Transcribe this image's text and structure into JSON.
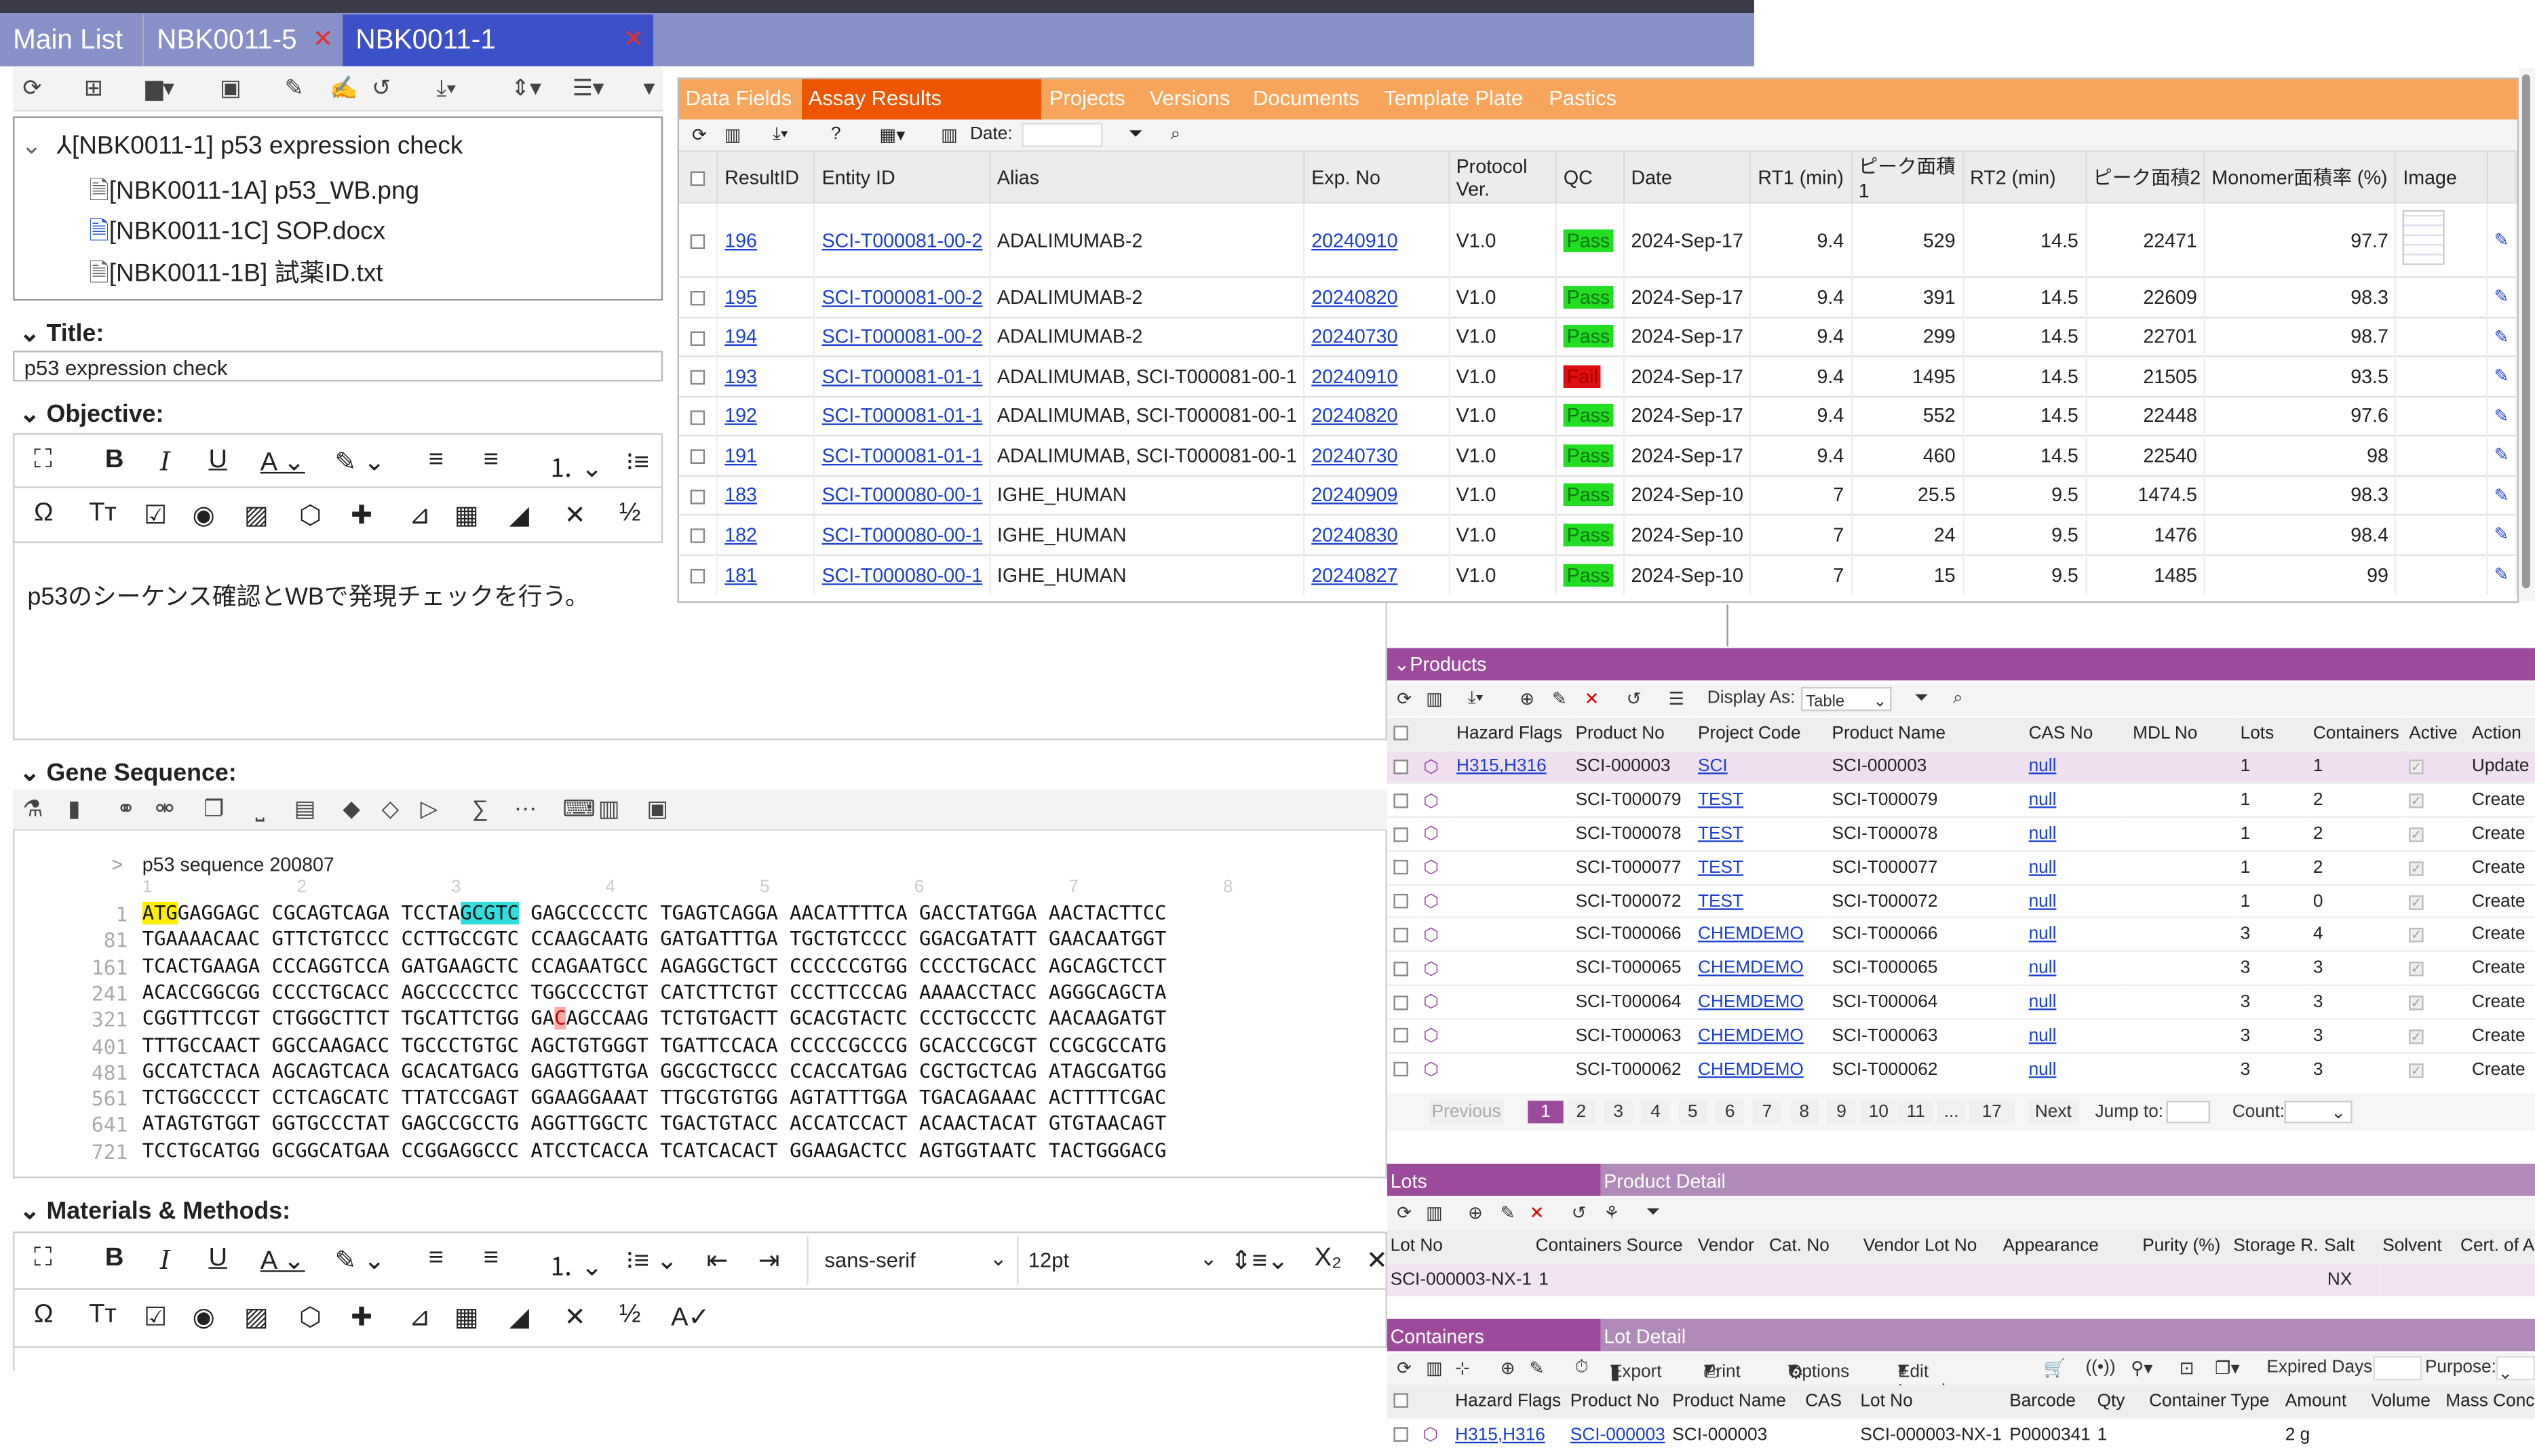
{
  "tabs": [
    {
      "label": "Main List"
    },
    {
      "label": "NBK0011-5",
      "close": "✕"
    },
    {
      "label": "NBK0011-1",
      "close": "✕"
    }
  ],
  "tree": {
    "root": "[NBK0011-1] p53 expression check",
    "items": [
      "[NBK0011-1A] p53_WB.png",
      "[NBK0011-1C] SOP.docx",
      "[NBK0011-1B] 試薬ID.txt"
    ]
  },
  "title": {
    "label": "Title:",
    "value": "p53 expression check"
  },
  "objective": {
    "label": "Objective:",
    "text": "p53のシーケンス確認とWBで発現チェックを行う。"
  },
  "gene": {
    "label": "Gene Sequence:",
    "seq_title": "p53 sequence 200807",
    "ruler": [
      "1",
      "2",
      "3",
      "4",
      "5",
      "6",
      "7",
      "8"
    ],
    "lines": [
      {
        "n": "1",
        "parts": [
          "",
          "ATG",
          "GAGGAGC CGCAGTCAGA TCCTA",
          "GCGTC",
          " GAGCCCCCTC TGAGTCAGGA AACATTTTCA GACCTATGGA AACTACTTCC"
        ]
      },
      {
        "n": "81",
        "t": "TGAAAACAAC GTTCTGTCCC CCTTGCCGTC CCAAGCAATG GATGATTTGA TGCTGTCCCC GGACGATATT GAACAATGGT"
      },
      {
        "n": "161",
        "t": "TCACTGAAGA CCCAGGTCCA GATGAAGCTC CCAGAATGCC AGAGGCTGCT CCCCCCGTGG CCCCTGCACC AGCAGCTCCT"
      },
      {
        "n": "241",
        "t": "ACACCGGCGG CCCCTGCACC AGCCCCCTCC TGGCCCCTGT CATCTTCTGT CCCTTCCCAG AAAACCTACC AGGGCAGCTA"
      },
      {
        "n": "321",
        "parts": [
          "CGGTTTCCGT CTGGGCTTCT TGCATTCTGG GA",
          "C",
          "AGCCAAG TCTGTGACTT GCACGTACTC CCCTGCCCTC AACAAGATGT"
        ]
      },
      {
        "n": "401",
        "t": "TTTGCCAACT GGCCAAGACC TGCCCTGTGC AGCTGTGGGT TGATTCCACA CCCCCGCCCG GCACCCGCGT CCGCGCCATG"
      },
      {
        "n": "481",
        "t": "GCCATCTACA AGCAGTCACA GCACATGACG GAGGTTGTGA GGCGCTGCCC CCACCATGAG CGCTGCTCAG ATAGCGATGG"
      },
      {
        "n": "561",
        "t": "TCTGGCCCCT CCTCAGCATC TTATCCGAGT GGAAGGAAAT TTGCGTGTGG AGTATTTGGA TGACAGAAAC ACTTTTCGAC"
      },
      {
        "n": "641",
        "t": "ATAGTGTGGT GGTGCCCTAT GAGCCGCCTG AGGTTGGCTC TGACTGTACC ACCATCCACT ACAACTACAT GTGTAACAGT"
      },
      {
        "n": "721",
        "t": "TCCTGCATGG GCGGCATGAA CCGGAGGCCC ATCCTCACCA TCATCACACT GGAAGACTCC AGTGGTAATC TACTGGGACG"
      }
    ]
  },
  "methods": {
    "label": "Materials & Methods:",
    "font": "sans-serif",
    "size": "12pt"
  },
  "assay": {
    "tabs": [
      "Data Fields",
      "Assay Results",
      "Projects",
      "Versions",
      "Documents",
      "Template Plate",
      "Pastics"
    ],
    "date_label": "Date:",
    "columns": [
      "ResultID",
      "Entity ID",
      "Alias",
      "Exp. No",
      "Protocol Ver.",
      "QC",
      "Date",
      "RT1 (min)",
      "ピーク面積1",
      "RT2 (min)",
      "ピーク面積2",
      "Monomer面積率 (%)",
      "Image"
    ],
    "rows": [
      {
        "id": "196",
        "entity": "SCI-T000081-00-2",
        "alias": "ADALIMUMAB-2",
        "exp": "20240910",
        "ver": "V1.0",
        "qc": "Pass",
        "date": "2024-Sep-17",
        "rt1": "9.4",
        "p1": "529",
        "rt2": "14.5",
        "p2": "22471",
        "mono": "97.7"
      },
      {
        "id": "195",
        "entity": "SCI-T000081-00-2",
        "alias": "ADALIMUMAB-2",
        "exp": "20240820",
        "ver": "V1.0",
        "qc": "Pass",
        "date": "2024-Sep-17",
        "rt1": "9.4",
        "p1": "391",
        "rt2": "14.5",
        "p2": "22609",
        "mono": "98.3"
      },
      {
        "id": "194",
        "entity": "SCI-T000081-00-2",
        "alias": "ADALIMUMAB-2",
        "exp": "20240730",
        "ver": "V1.0",
        "qc": "Pass",
        "date": "2024-Sep-17",
        "rt1": "9.4",
        "p1": "299",
        "rt2": "14.5",
        "p2": "22701",
        "mono": "98.7"
      },
      {
        "id": "193",
        "entity": "SCI-T000081-01-1",
        "alias": "ADALIMUMAB, SCI-T000081-00-1",
        "exp": "20240910",
        "ver": "V1.0",
        "qc": "Fail",
        "date": "2024-Sep-17",
        "rt1": "9.4",
        "p1": "1495",
        "rt2": "14.5",
        "p2": "21505",
        "mono": "93.5"
      },
      {
        "id": "192",
        "entity": "SCI-T000081-01-1",
        "alias": "ADALIMUMAB, SCI-T000081-00-1",
        "exp": "20240820",
        "ver": "V1.0",
        "qc": "Pass",
        "date": "2024-Sep-17",
        "rt1": "9.4",
        "p1": "552",
        "rt2": "14.5",
        "p2": "22448",
        "mono": "97.6"
      },
      {
        "id": "191",
        "entity": "SCI-T000081-01-1",
        "alias": "ADALIMUMAB, SCI-T000081-00-1",
        "exp": "20240730",
        "ver": "V1.0",
        "qc": "Pass",
        "date": "2024-Sep-17",
        "rt1": "9.4",
        "p1": "460",
        "rt2": "14.5",
        "p2": "22540",
        "mono": "98"
      },
      {
        "id": "183",
        "entity": "SCI-T000080-00-1",
        "alias": "IGHE_HUMAN",
        "exp": "20240909",
        "ver": "V1.0",
        "qc": "Pass",
        "date": "2024-Sep-10",
        "rt1": "7",
        "p1": "25.5",
        "rt2": "9.5",
        "p2": "1474.5",
        "mono": "98.3"
      },
      {
        "id": "182",
        "entity": "SCI-T000080-00-1",
        "alias": "IGHE_HUMAN",
        "exp": "20240830",
        "ver": "V1.0",
        "qc": "Pass",
        "date": "2024-Sep-10",
        "rt1": "7",
        "p1": "24",
        "rt2": "9.5",
        "p2": "1476",
        "mono": "98.4"
      },
      {
        "id": "181",
        "entity": "SCI-T000080-00-1",
        "alias": "IGHE_HUMAN",
        "exp": "20240827",
        "ver": "V1.0",
        "qc": "Pass",
        "date": "2024-Sep-10",
        "rt1": "7",
        "p1": "15",
        "rt2": "9.5",
        "p2": "1485",
        "mono": "99"
      }
    ]
  },
  "products": {
    "header": "Products",
    "display_as": "Display As:",
    "display_value": "Table",
    "columns": [
      "Hazard Flags",
      "Product No",
      "Project Code",
      "Product Name",
      "CAS No",
      "MDL No",
      "Lots",
      "Containers",
      "Active",
      "Action"
    ],
    "rows": [
      {
        "haz": "H315,H316",
        "no": "SCI-000003",
        "proj": "SCI",
        "name": "SCI-000003",
        "cas": "null",
        "lots": "1",
        "cont": "1",
        "action": "Update"
      },
      {
        "haz": "",
        "no": "SCI-T000079",
        "proj": "TEST",
        "name": "SCI-T000079",
        "cas": "null",
        "lots": "1",
        "cont": "2",
        "action": "Create"
      },
      {
        "haz": "",
        "no": "SCI-T000078",
        "proj": "TEST",
        "name": "SCI-T000078",
        "cas": "null",
        "lots": "1",
        "cont": "2",
        "action": "Create"
      },
      {
        "haz": "",
        "no": "SCI-T000077",
        "proj": "TEST",
        "name": "SCI-T000077",
        "cas": "null",
        "lots": "1",
        "cont": "2",
        "action": "Create"
      },
      {
        "haz": "",
        "no": "SCI-T000072",
        "proj": "TEST",
        "name": "SCI-T000072",
        "cas": "null",
        "lots": "1",
        "cont": "0",
        "action": "Create"
      },
      {
        "haz": "",
        "no": "SCI-T000066",
        "proj": "CHEMDEMO",
        "name": "SCI-T000066",
        "cas": "null",
        "lots": "3",
        "cont": "4",
        "action": "Create"
      },
      {
        "haz": "",
        "no": "SCI-T000065",
        "proj": "CHEMDEMO",
        "name": "SCI-T000065",
        "cas": "null",
        "lots": "3",
        "cont": "3",
        "action": "Create"
      },
      {
        "haz": "",
        "no": "SCI-T000064",
        "proj": "CHEMDEMO",
        "name": "SCI-T000064",
        "cas": "null",
        "lots": "3",
        "cont": "3",
        "action": "Create"
      },
      {
        "haz": "",
        "no": "SCI-T000063",
        "proj": "CHEMDEMO",
        "name": "SCI-T000063",
        "cas": "null",
        "lots": "3",
        "cont": "3",
        "action": "Create"
      },
      {
        "haz": "",
        "no": "SCI-T000062",
        "proj": "CHEMDEMO",
        "name": "SCI-T000062",
        "cas": "null",
        "lots": "3",
        "cont": "3",
        "action": "Create"
      }
    ],
    "pager": {
      "prev": "Previous",
      "pages": [
        "1",
        "2",
        "3",
        "4",
        "5",
        "6",
        "7",
        "8",
        "9",
        "10",
        "11",
        "...",
        "17"
      ],
      "next": "Next",
      "jump": "Jump to:",
      "count": "Count:"
    }
  },
  "lots": {
    "tab": "Lots",
    "tab2": "Product Detail",
    "columns": [
      "Lot No",
      "Containers",
      "Source",
      "Vendor",
      "Cat. No",
      "Vendor Lot No",
      "Appearance",
      "Purity (%)",
      "Storage R.",
      "Salt",
      "Solvent",
      "Cert. of A"
    ],
    "row": {
      "lot": "SCI-000003-NX-1",
      "cont": "1",
      "salt": "NX"
    }
  },
  "containers": {
    "tab": "Containers",
    "tab2": "Lot Detail",
    "toolbar": {
      "export": "Export",
      "print": "Print",
      "options": "Options",
      "edit_location": "Edit Location",
      "expired": "Expired Days:",
      "purpose": "Purpose:"
    },
    "columns": [
      "Hazard Flags",
      "Product No",
      "Product Name",
      "CAS",
      "Lot No",
      "Barcode",
      "Qty",
      "Container Type",
      "Amount",
      "Volume",
      "Mass Conc"
    ],
    "row": {
      "haz": "H315,H316",
      "no": "SCI-000003",
      "name": "SCI-000003",
      "lot": "SCI-000003-NX-1",
      "barcode": "P0000341",
      "qty": "1",
      "amount": "2 g"
    }
  }
}
